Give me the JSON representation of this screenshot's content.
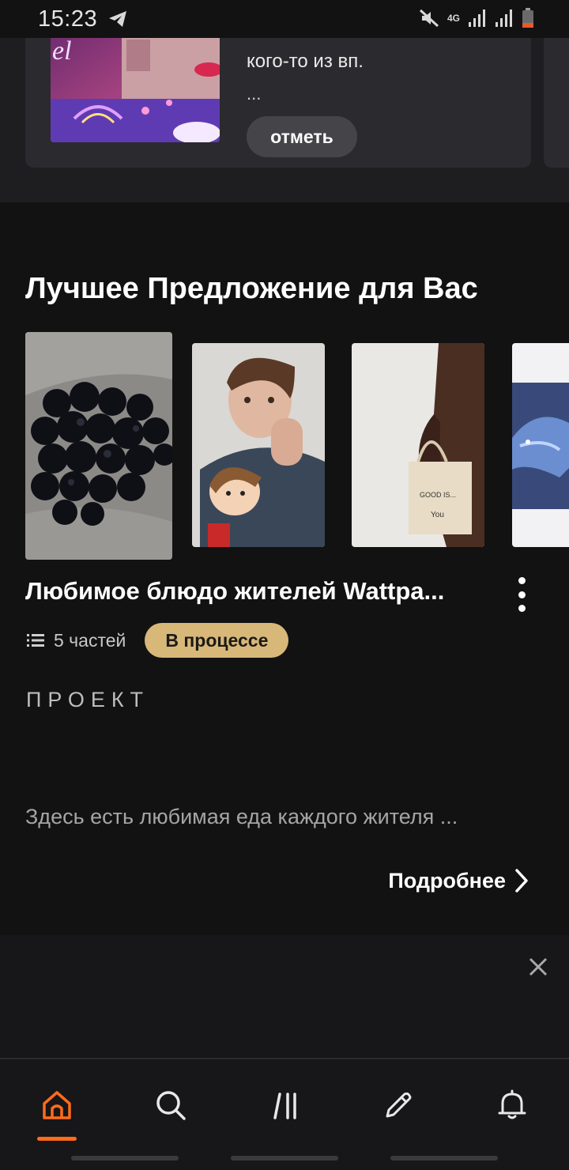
{
  "status_bar": {
    "time": "15:23",
    "network": "4G"
  },
  "story_card": {
    "text_line": "кого-то из вп.",
    "ellipsis": "...",
    "button_label": "отметь"
  },
  "section": {
    "title": "Лучшее Предложение для Вас"
  },
  "book": {
    "title": "Любимое блюдо жителей  Wattpa...",
    "parts": "5 частей",
    "status": "В процессе",
    "category": "ПРОЕКТ",
    "description": "Здесь есть любимая еда каждого жителя ...",
    "details_label": "Подробнее"
  },
  "colors": {
    "accent": "#ff6c1a",
    "badge": "#d7b879",
    "background": "#121212"
  },
  "nav": {
    "items": [
      "home-icon",
      "search-icon",
      "library-icon",
      "write-icon",
      "bell-icon"
    ],
    "active": "home-icon"
  }
}
